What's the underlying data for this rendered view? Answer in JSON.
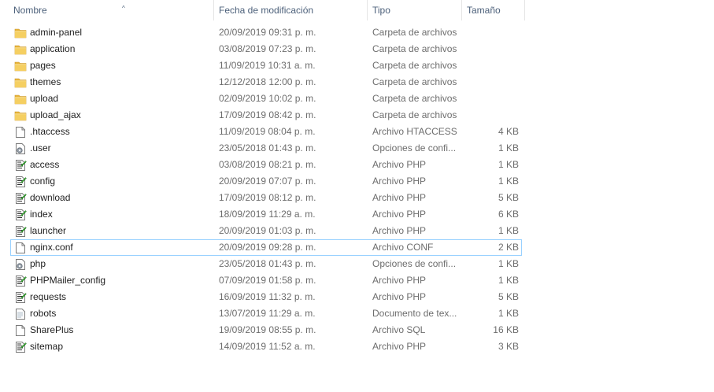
{
  "columns": {
    "name": "Nombre",
    "date": "Fecha de modificación",
    "type": "Tipo",
    "size": "Tamaño"
  },
  "files": [
    {
      "name": "admin-panel",
      "date": "20/09/2019 09:31 p. m.",
      "type": "Carpeta de archivos",
      "size": "",
      "icon": "folder-icon"
    },
    {
      "name": "application",
      "date": "03/08/2019 07:23 p. m.",
      "type": "Carpeta de archivos",
      "size": "",
      "icon": "folder-icon"
    },
    {
      "name": "pages",
      "date": "11/09/2019 10:31 a. m.",
      "type": "Carpeta de archivos",
      "size": "",
      "icon": "folder-icon"
    },
    {
      "name": "themes",
      "date": "12/12/2018 12:00 p. m.",
      "type": "Carpeta de archivos",
      "size": "",
      "icon": "folder-icon"
    },
    {
      "name": "upload",
      "date": "02/09/2019 10:02 p. m.",
      "type": "Carpeta de archivos",
      "size": "",
      "icon": "folder-icon"
    },
    {
      "name": "upload_ajax",
      "date": "17/09/2019 08:42 p. m.",
      "type": "Carpeta de archivos",
      "size": "",
      "icon": "folder-icon"
    },
    {
      "name": ".htaccess",
      "date": "11/09/2019 08:04 p. m.",
      "type": "Archivo HTACCESS",
      "size": "4 KB",
      "icon": "blank-file-icon"
    },
    {
      "name": ".user",
      "date": "23/05/2018 01:43 p. m.",
      "type": "Opciones de confi...",
      "size": "1 KB",
      "icon": "config-file-icon"
    },
    {
      "name": "access",
      "date": "03/08/2019 08:21 p. m.",
      "type": "Archivo PHP",
      "size": "1 KB",
      "icon": "php-file-icon"
    },
    {
      "name": "config",
      "date": "20/09/2019 07:07 p. m.",
      "type": "Archivo PHP",
      "size": "1 KB",
      "icon": "php-file-icon"
    },
    {
      "name": "download",
      "date": "17/09/2019 08:12 p. m.",
      "type": "Archivo PHP",
      "size": "5 KB",
      "icon": "php-file-icon"
    },
    {
      "name": "index",
      "date": "18/09/2019 11:29 a. m.",
      "type": "Archivo PHP",
      "size": "6 KB",
      "icon": "php-file-icon"
    },
    {
      "name": "launcher",
      "date": "20/09/2019 01:03 p. m.",
      "type": "Archivo PHP",
      "size": "1 KB",
      "icon": "php-file-icon"
    },
    {
      "name": "nginx.conf",
      "date": "20/09/2019 09:28 p. m.",
      "type": "Archivo CONF",
      "size": "2 KB",
      "icon": "blank-file-icon",
      "selected": true
    },
    {
      "name": "php",
      "date": "23/05/2018 01:43 p. m.",
      "type": "Opciones de confi...",
      "size": "1 KB",
      "icon": "config-file-icon"
    },
    {
      "name": "PHPMailer_config",
      "date": "07/09/2019 01:58 p. m.",
      "type": "Archivo PHP",
      "size": "1 KB",
      "icon": "php-file-icon"
    },
    {
      "name": "requests",
      "date": "16/09/2019 11:32 p. m.",
      "type": "Archivo PHP",
      "size": "5 KB",
      "icon": "php-file-icon"
    },
    {
      "name": "robots",
      "date": "13/07/2019 11:29 a. m.",
      "type": "Documento de tex...",
      "size": "1 KB",
      "icon": "text-file-icon"
    },
    {
      "name": "SharePlus",
      "date": "19/09/2019 08:55 p. m.",
      "type": "Archivo SQL",
      "size": "16 KB",
      "icon": "blank-file-icon"
    },
    {
      "name": "sitemap",
      "date": "14/09/2019 11:52 a. m.",
      "type": "Archivo PHP",
      "size": "3 KB",
      "icon": "php-file-icon"
    }
  ],
  "colors": {
    "header_text": "#4c607a",
    "selection_border": "#99d1ff",
    "folder": "#e8b53a"
  }
}
